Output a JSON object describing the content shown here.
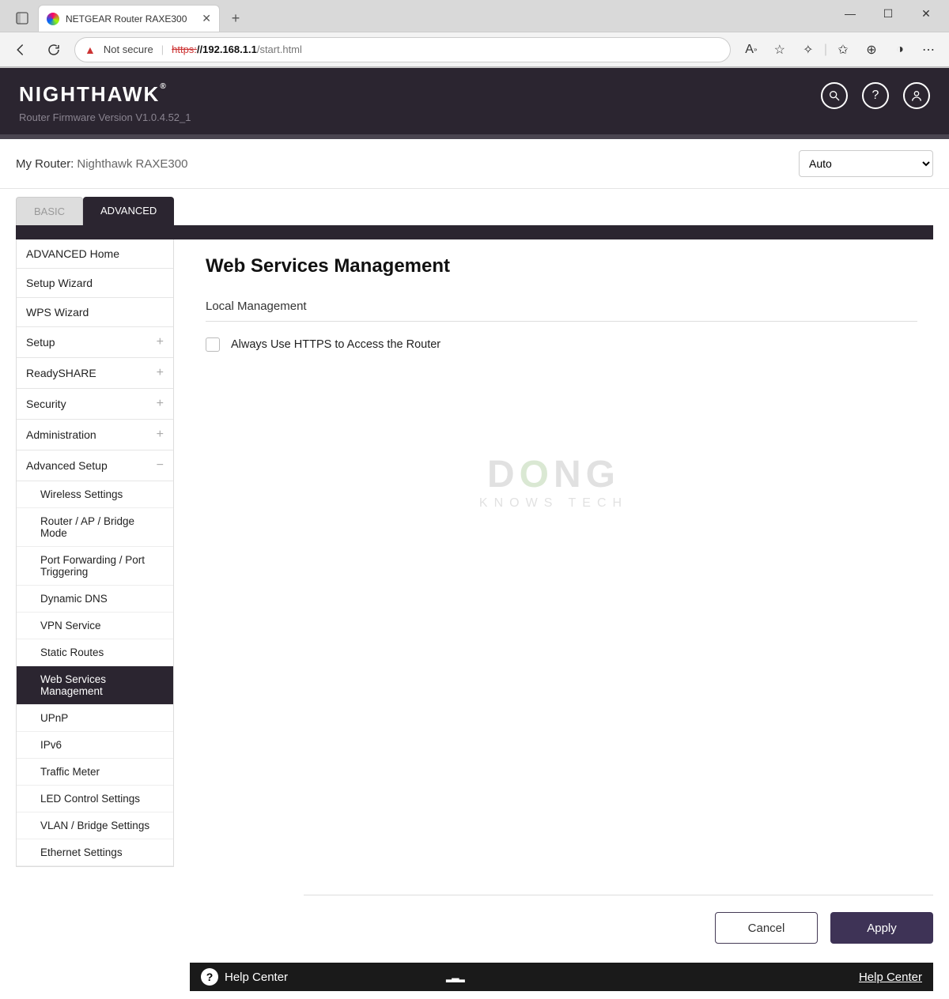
{
  "browser": {
    "tab_title": "NETGEAR Router RAXE300",
    "not_secure": "Not secure",
    "url_scheme": "https:",
    "url_host": "//192.168.1.1",
    "url_path": "/start.html"
  },
  "header": {
    "brand": "NIGHTHAWK",
    "firmware": "Router Firmware Version V1.0.4.52_1"
  },
  "subheader": {
    "label": "My Router:",
    "value": "Nighthawk RAXE300",
    "dropdown_selected": "Auto"
  },
  "tabs": {
    "basic": "BASIC",
    "advanced": "ADVANCED"
  },
  "sidebar": {
    "items": [
      {
        "label": "ADVANCED Home",
        "type": "link"
      },
      {
        "label": "Setup Wizard",
        "type": "link"
      },
      {
        "label": "WPS Wizard",
        "type": "link"
      },
      {
        "label": "Setup",
        "type": "group",
        "icon": "+"
      },
      {
        "label": "ReadySHARE",
        "type": "group",
        "icon": "+"
      },
      {
        "label": "Security",
        "type": "group",
        "icon": "+"
      },
      {
        "label": "Administration",
        "type": "group",
        "icon": "+"
      },
      {
        "label": "Advanced Setup",
        "type": "group",
        "icon": "−"
      }
    ],
    "advanced_setup_children": [
      "Wireless Settings",
      "Router / AP / Bridge Mode",
      "Port Forwarding / Port Triggering",
      "Dynamic DNS",
      "VPN Service",
      "Static Routes",
      "Web Services Management",
      "UPnP",
      "IPv6",
      "Traffic Meter",
      "LED Control Settings",
      "VLAN / Bridge Settings",
      "Ethernet Settings"
    ],
    "active_child": "Web Services Management"
  },
  "main": {
    "title": "Web Services Management",
    "section": "Local Management",
    "checkbox_label": "Always Use HTTPS to Access the Router",
    "checkbox_checked": false
  },
  "buttons": {
    "cancel": "Cancel",
    "apply": "Apply"
  },
  "helpbar": {
    "title": "Help Center",
    "link": "Help Center"
  },
  "watermark": {
    "line1_pre": "D",
    "line1_o": "O",
    "line1_post": "NG",
    "line2": "KNOWS TECH"
  }
}
